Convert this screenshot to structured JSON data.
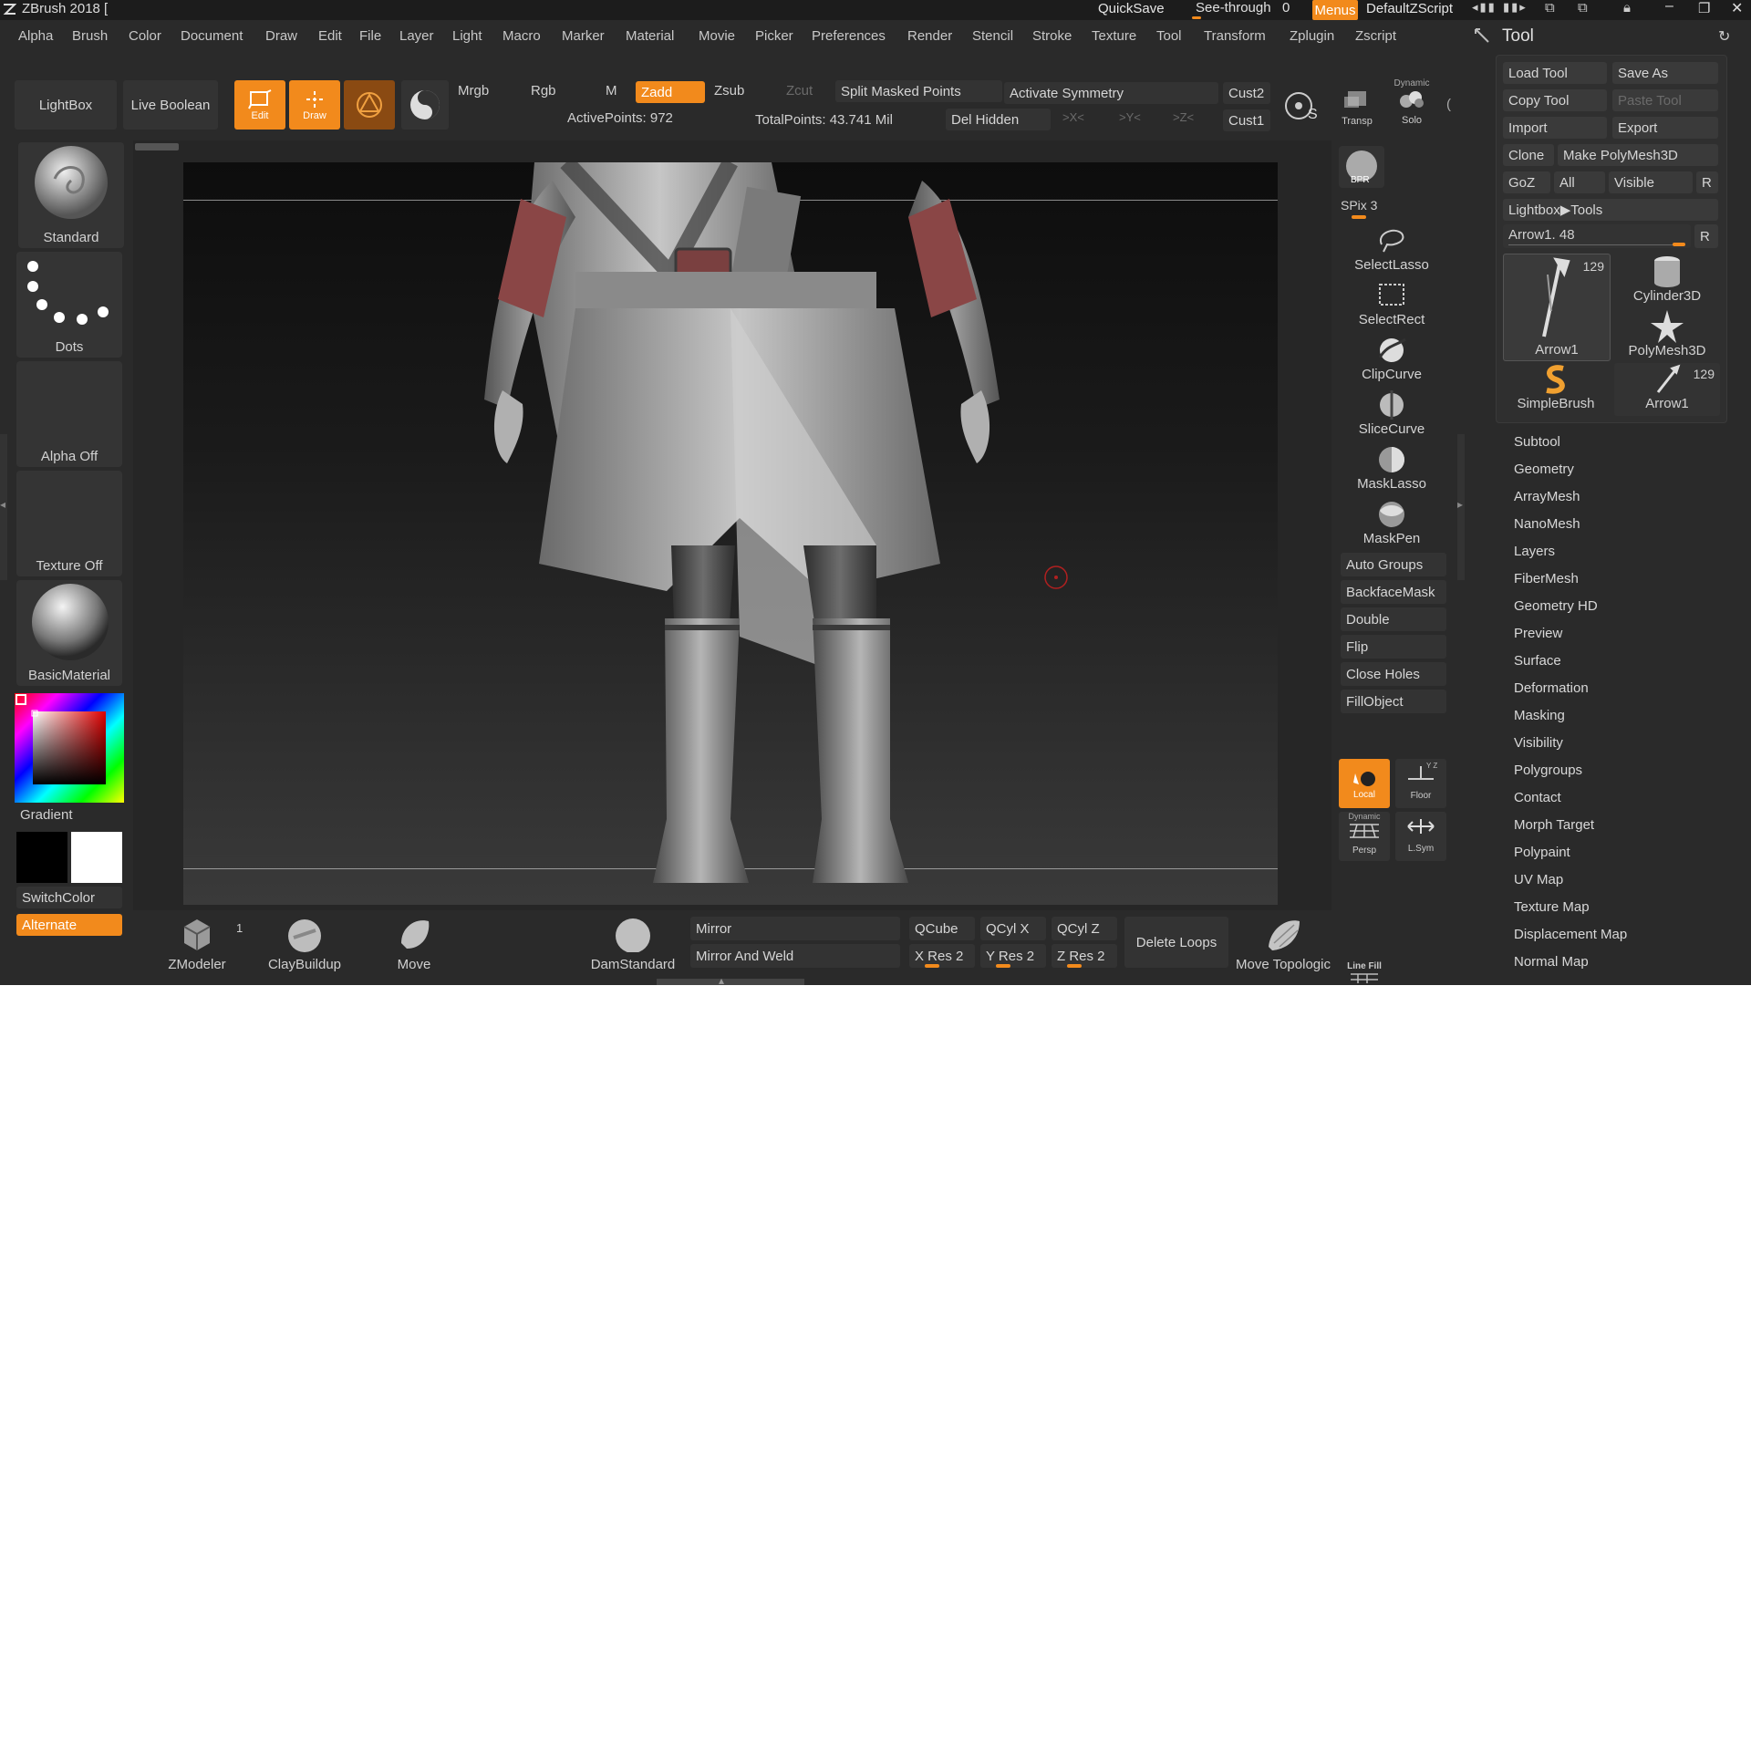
{
  "title_bar": {
    "app_title": "ZBrush 2018 [",
    "quicksave": "QuickSave",
    "see_through_label": "See-through",
    "see_through_value": "0",
    "menus_label": "Menus",
    "script_label": "DefaultZScript"
  },
  "menu_bar": [
    "Alpha",
    "Brush",
    "Color",
    "Document",
    "Draw",
    "Edit",
    "File",
    "Layer",
    "Light",
    "Macro",
    "Marker",
    "Material",
    "Movie",
    "Picker",
    "Preferences",
    "Render",
    "Stencil",
    "Stroke",
    "Texture",
    "Tool",
    "Transform",
    "Zplugin",
    "Zscript"
  ],
  "top_shelf": {
    "lightbox": "LightBox",
    "live_boolean": "Live Boolean",
    "edit": "Edit",
    "draw": "Draw",
    "mrgb": "Mrgb",
    "rgb": "Rgb",
    "m": "M",
    "zadd": "Zadd",
    "zsub": "Zsub",
    "zcut": "Zcut",
    "split_masked": "Split Masked Points",
    "activate_symmetry": "Activate Symmetry",
    "del_hidden": "Del Hidden",
    "x_sym": ">X<",
    "y_sym": ">Y<",
    "z_sym": ">Z<",
    "cust2": "Cust2",
    "cust1": "Cust1",
    "active_points": "ActivePoints: 972",
    "total_points": "TotalPoints: 43.741 Mil",
    "transp": "Transp",
    "dynamic": "Dynamic",
    "solo": "Solo"
  },
  "left_shelf": {
    "brush": "Standard",
    "stroke": "Dots",
    "alpha": "Alpha Off",
    "texture": "Texture Off",
    "material": "BasicMaterial",
    "gradient": "Gradient",
    "switch_color": "SwitchColor",
    "alternate": "Alternate",
    "main_color": "#000000",
    "secondary_color": "#ffffff"
  },
  "right_shelf": {
    "bpr": "BPR",
    "spix": "SPix 3",
    "tools": [
      "SelectLasso",
      "SelectRect",
      "ClipCurve",
      "SliceCurve",
      "MaskLasso",
      "MaskPen"
    ],
    "buttons": [
      "Auto Groups",
      "BackfaceMask",
      "Double",
      "Flip",
      "Close Holes",
      "FillObject"
    ],
    "local": "Local",
    "floor": "Floor",
    "dynamic": "Dynamic",
    "persp": "Persp",
    "lsym": "L.Sym",
    "line_fill": "Line Fill"
  },
  "bottom_shelf": {
    "zmodeler": "ZModeler",
    "zmodeler_count": "1",
    "claybuildup": "ClayBuildup",
    "move": "Move",
    "damstandard": "DamStandard",
    "mirror": "Mirror",
    "mirror_weld": "Mirror And Weld",
    "qcube": "QCube",
    "qcylx": "QCyl X",
    "qcylz": "QCyl Z",
    "xres": "X Res 2",
    "yres": "Y Res 2",
    "zres": "Z Res 2",
    "delete_loops": "Delete Loops",
    "move_topological": "Move Topologic"
  },
  "tool_palette": {
    "title": "Tool",
    "load_tool": "Load Tool",
    "save_as": "Save As",
    "copy_tool": "Copy Tool",
    "paste_tool": "Paste Tool",
    "import": "Import",
    "export": "Export",
    "clone": "Clone",
    "make_polymesh": "Make PolyMesh3D",
    "goz": "GoZ",
    "all": "All",
    "visible": "Visible",
    "r": "R",
    "lightbox_tools": "Lightbox▶Tools",
    "current_tool": "Arrow1. 48",
    "thumbs": [
      {
        "label": "Arrow1",
        "count": "129"
      },
      {
        "label": "Cylinder3D",
        "count": ""
      },
      {
        "label": "PolyMesh3D",
        "count": ""
      },
      {
        "label": "SimpleBrush",
        "count": ""
      },
      {
        "label": "Arrow1",
        "count": "129"
      }
    ],
    "subpalettes": [
      "Subtool",
      "Geometry",
      "ArrayMesh",
      "NanoMesh",
      "Layers",
      "FiberMesh",
      "Geometry HD",
      "Preview",
      "Surface",
      "Deformation",
      "Masking",
      "Visibility",
      "Polygroups",
      "Contact",
      "Morph Target",
      "Polypaint",
      "UV Map",
      "Texture Map",
      "Displacement Map",
      "Normal Map"
    ]
  },
  "colors": {
    "accent": "#f28a1c",
    "ui_background": "#2a2a2a",
    "button": "#3a3a3a"
  }
}
